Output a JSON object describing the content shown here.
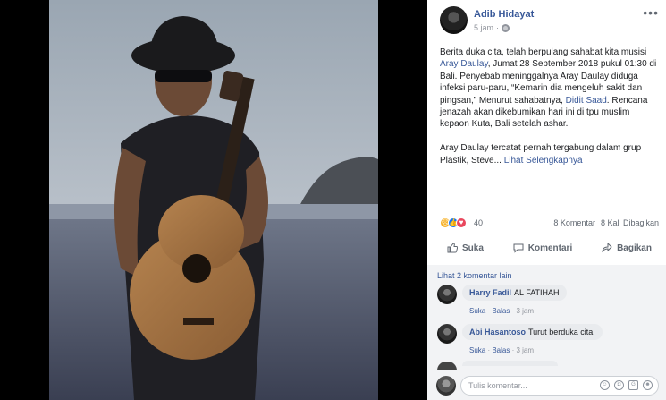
{
  "photo": {
    "description_icon": "musician-with-guitar-photo"
  },
  "post": {
    "author": "Adib Hidayat",
    "time": "5 jam",
    "paragraph1": [
      {
        "text": "Berita duka cita, telah berpulang sahabat kita musisi ",
        "link": false
      },
      {
        "text": "Aray Daulay",
        "link": true
      },
      {
        "text": ", Jumat 28 September 2018 pukul 01:30 di Bali. Penyebab meninggalnya Aray Daulay diduga infeksi paru-paru, “Kemarin dia mengeluh sakit dan pingsan,” Menurut sahabatnya, ",
        "link": false
      },
      {
        "text": "Didit Saad",
        "link": true
      },
      {
        "text": ". Rencana jenazah akan dikebumikan hari ini di tpu muslim kepaon Kuta, Bali setelah ashar.",
        "link": false
      }
    ],
    "paragraph2": "Aray Daulay tercatat pernah tergabung dalam grup Plastik, Steve...",
    "see_more": "Lihat Selengkapnya"
  },
  "reactions": {
    "count": "40",
    "comments": "8 Komentar",
    "shares": "8 Kali Dibagikan"
  },
  "actions": {
    "like": "Suka",
    "comment": "Komentari",
    "share": "Bagikan"
  },
  "comments": {
    "more_link": "Lihat 2 komentar lain",
    "items": [
      {
        "name": "Harry Fadil",
        "text": "AL FATIHAH",
        "like": "Suka",
        "reply": "Balas",
        "time": "3 jam"
      },
      {
        "name": "Abi Hasantoso",
        "text": "Turut berduka cita.",
        "like": "Suka",
        "reply": "Balas",
        "time": "3 jam"
      }
    ]
  },
  "composer": {
    "placeholder": "Tulis komentar..."
  }
}
